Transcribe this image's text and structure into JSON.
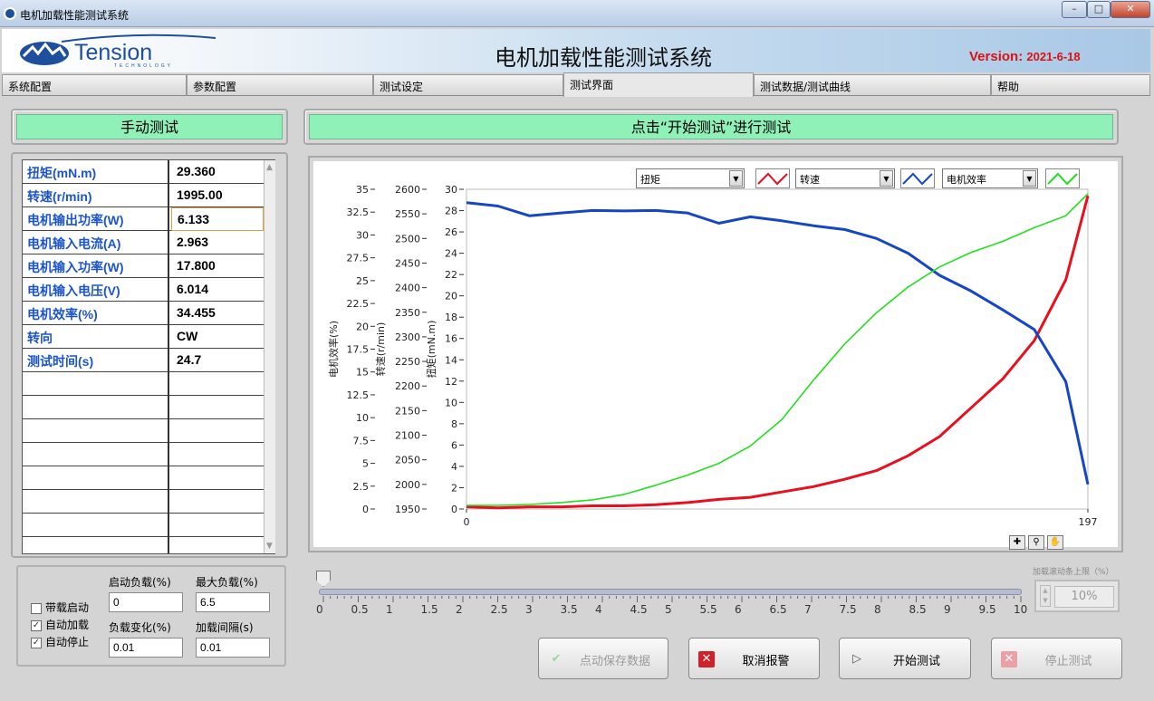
{
  "window": {
    "title": "电机加载性能测试系统"
  },
  "header": {
    "logo_text": "Tension",
    "logo_sub": "TECHNOLOGY",
    "title": "电机加载性能测试系统",
    "version_label": "Version:",
    "version_value": "2021-6-18"
  },
  "tabs": [
    {
      "label": "系统配置",
      "active": false
    },
    {
      "label": "参数配置",
      "active": false
    },
    {
      "label": "测试设定",
      "active": false
    },
    {
      "label": "测试界面",
      "active": true
    },
    {
      "label": "测试数据/测试曲线",
      "active": false
    },
    {
      "label": "帮助",
      "active": false
    }
  ],
  "left_panel": {
    "title": "手动测试"
  },
  "status_bar": {
    "text": "点击“开始测试”进行测试"
  },
  "readings": [
    {
      "label": "扭矩(mN.m)",
      "value": "29.360"
    },
    {
      "label": "转速(r/min)",
      "value": "1995.00"
    },
    {
      "label": "电机输出功率(W)",
      "value": "6.133"
    },
    {
      "label": "电机输入电流(A)",
      "value": "2.963"
    },
    {
      "label": "电机输入功率(W)",
      "value": "17.800"
    },
    {
      "label": "电机输入电压(V)",
      "value": "6.014"
    },
    {
      "label": "电机效率(%)",
      "value": "34.455"
    },
    {
      "label": "转向",
      "value": "CW"
    },
    {
      "label": "测试时间(s)",
      "value": "24.7"
    }
  ],
  "legend_selects": [
    {
      "selected": "扭矩",
      "color": "#e8101e"
    },
    {
      "selected": "转速",
      "color": "#1547c4"
    },
    {
      "selected": "电机效率",
      "color": "#22e01e"
    }
  ],
  "chart_data": {
    "type": "line",
    "xlim": [
      0,
      197
    ],
    "x_ticks": [
      "0",
      "197"
    ],
    "axes": [
      {
        "label": "电机效率(%)",
        "ylim": [
          0,
          35
        ],
        "ticks": [
          "0",
          "2.5",
          "5",
          "7.5",
          "10",
          "12.5",
          "15",
          "17.5",
          "20",
          "22.5",
          "25",
          "27.5",
          "30",
          "32.5",
          "35"
        ]
      },
      {
        "label": "转速(r/min)",
        "ylim": [
          1950,
          2600
        ],
        "ticks": [
          "1950",
          "2000",
          "2050",
          "2100",
          "2150",
          "2200",
          "2250",
          "2300",
          "2350",
          "2400",
          "2450",
          "2500",
          "2550",
          "2600"
        ]
      },
      {
        "label": "扭矩(mN.m)",
        "ylim": [
          0,
          30
        ],
        "ticks": [
          "0",
          "2",
          "4",
          "6",
          "8",
          "10",
          "12",
          "14",
          "16",
          "18",
          "20",
          "22",
          "24",
          "26",
          "28",
          "30"
        ]
      }
    ],
    "series": [
      {
        "name": "扭矩",
        "axis": 2,
        "color": "#e8101e",
        "x": [
          0,
          10,
          20,
          30,
          40,
          50,
          60,
          70,
          80,
          90,
          100,
          110,
          120,
          130,
          140,
          150,
          160,
          170,
          180,
          190,
          197
        ],
        "y": [
          0.2,
          0.1,
          0.2,
          0.2,
          0.3,
          0.3,
          0.4,
          0.6,
          0.9,
          1.1,
          1.6,
          2.1,
          2.8,
          3.6,
          5.0,
          6.8,
          9.5,
          12.2,
          15.8,
          21.5,
          29.4
        ]
      },
      {
        "name": "转速",
        "axis": 1,
        "color": "#1547c4",
        "x": [
          0,
          10,
          20,
          30,
          40,
          50,
          60,
          70,
          80,
          90,
          100,
          110,
          120,
          130,
          140,
          150,
          160,
          170,
          180,
          190,
          197
        ],
        "y": [
          2573,
          2566,
          2546,
          2552,
          2557,
          2556,
          2557,
          2552,
          2531,
          2544,
          2536,
          2526,
          2518,
          2500,
          2470,
          2425,
          2393,
          2355,
          2315,
          2209,
          2000
        ]
      },
      {
        "name": "电机效率",
        "axis": 0,
        "color": "#22e01e",
        "x": [
          0,
          10,
          20,
          30,
          40,
          50,
          60,
          70,
          80,
          90,
          100,
          110,
          120,
          130,
          140,
          150,
          160,
          170,
          180,
          190,
          197
        ],
        "y": [
          0.4,
          0.4,
          0.5,
          0.7,
          1.0,
          1.6,
          2.6,
          3.7,
          5.0,
          6.9,
          9.8,
          14.1,
          18.1,
          21.5,
          24.3,
          26.5,
          28.1,
          29.3,
          30.8,
          32.1,
          34.5
        ]
      }
    ]
  },
  "load": {
    "start_label": "启动负载(%)",
    "start_value": "0",
    "max_label": "最大负载(%)",
    "max_value": "6.5",
    "change_label": "负载变化(%)",
    "change_value": "0.01",
    "interval_label": "加载间隔(s)",
    "interval_value": "0.01",
    "checks": [
      {
        "label": "带载启动",
        "checked": false
      },
      {
        "label": "自动加载",
        "checked": true
      },
      {
        "label": "自动停止",
        "checked": true
      }
    ]
  },
  "slider": {
    "value": 0,
    "ticks": [
      "0",
      "0.5",
      "1",
      "1.5",
      "2",
      "2.5",
      "3",
      "3.5",
      "4",
      "4.5",
      "5",
      "5.5",
      "6",
      "6.5",
      "7",
      "7.5",
      "8",
      "8.5",
      "9",
      "9.5",
      "10"
    ]
  },
  "scroll_limit": {
    "label": "加载滚动条上限（%）",
    "value": "10%"
  },
  "buttons": {
    "save": {
      "label": "点动保存数据",
      "enabled": false
    },
    "cancel_alarm": {
      "label": "取消报警",
      "enabled": true
    },
    "start": {
      "label": "开始测试",
      "enabled": true
    },
    "stop": {
      "label": "停止测试",
      "enabled": false
    }
  },
  "colors": {
    "accent_green": "#8ff0b8",
    "torque": "#e8101e",
    "speed": "#1547c4",
    "efficiency": "#22e01e",
    "label_blue": "#1c55c8",
    "version_red": "#d11111"
  }
}
